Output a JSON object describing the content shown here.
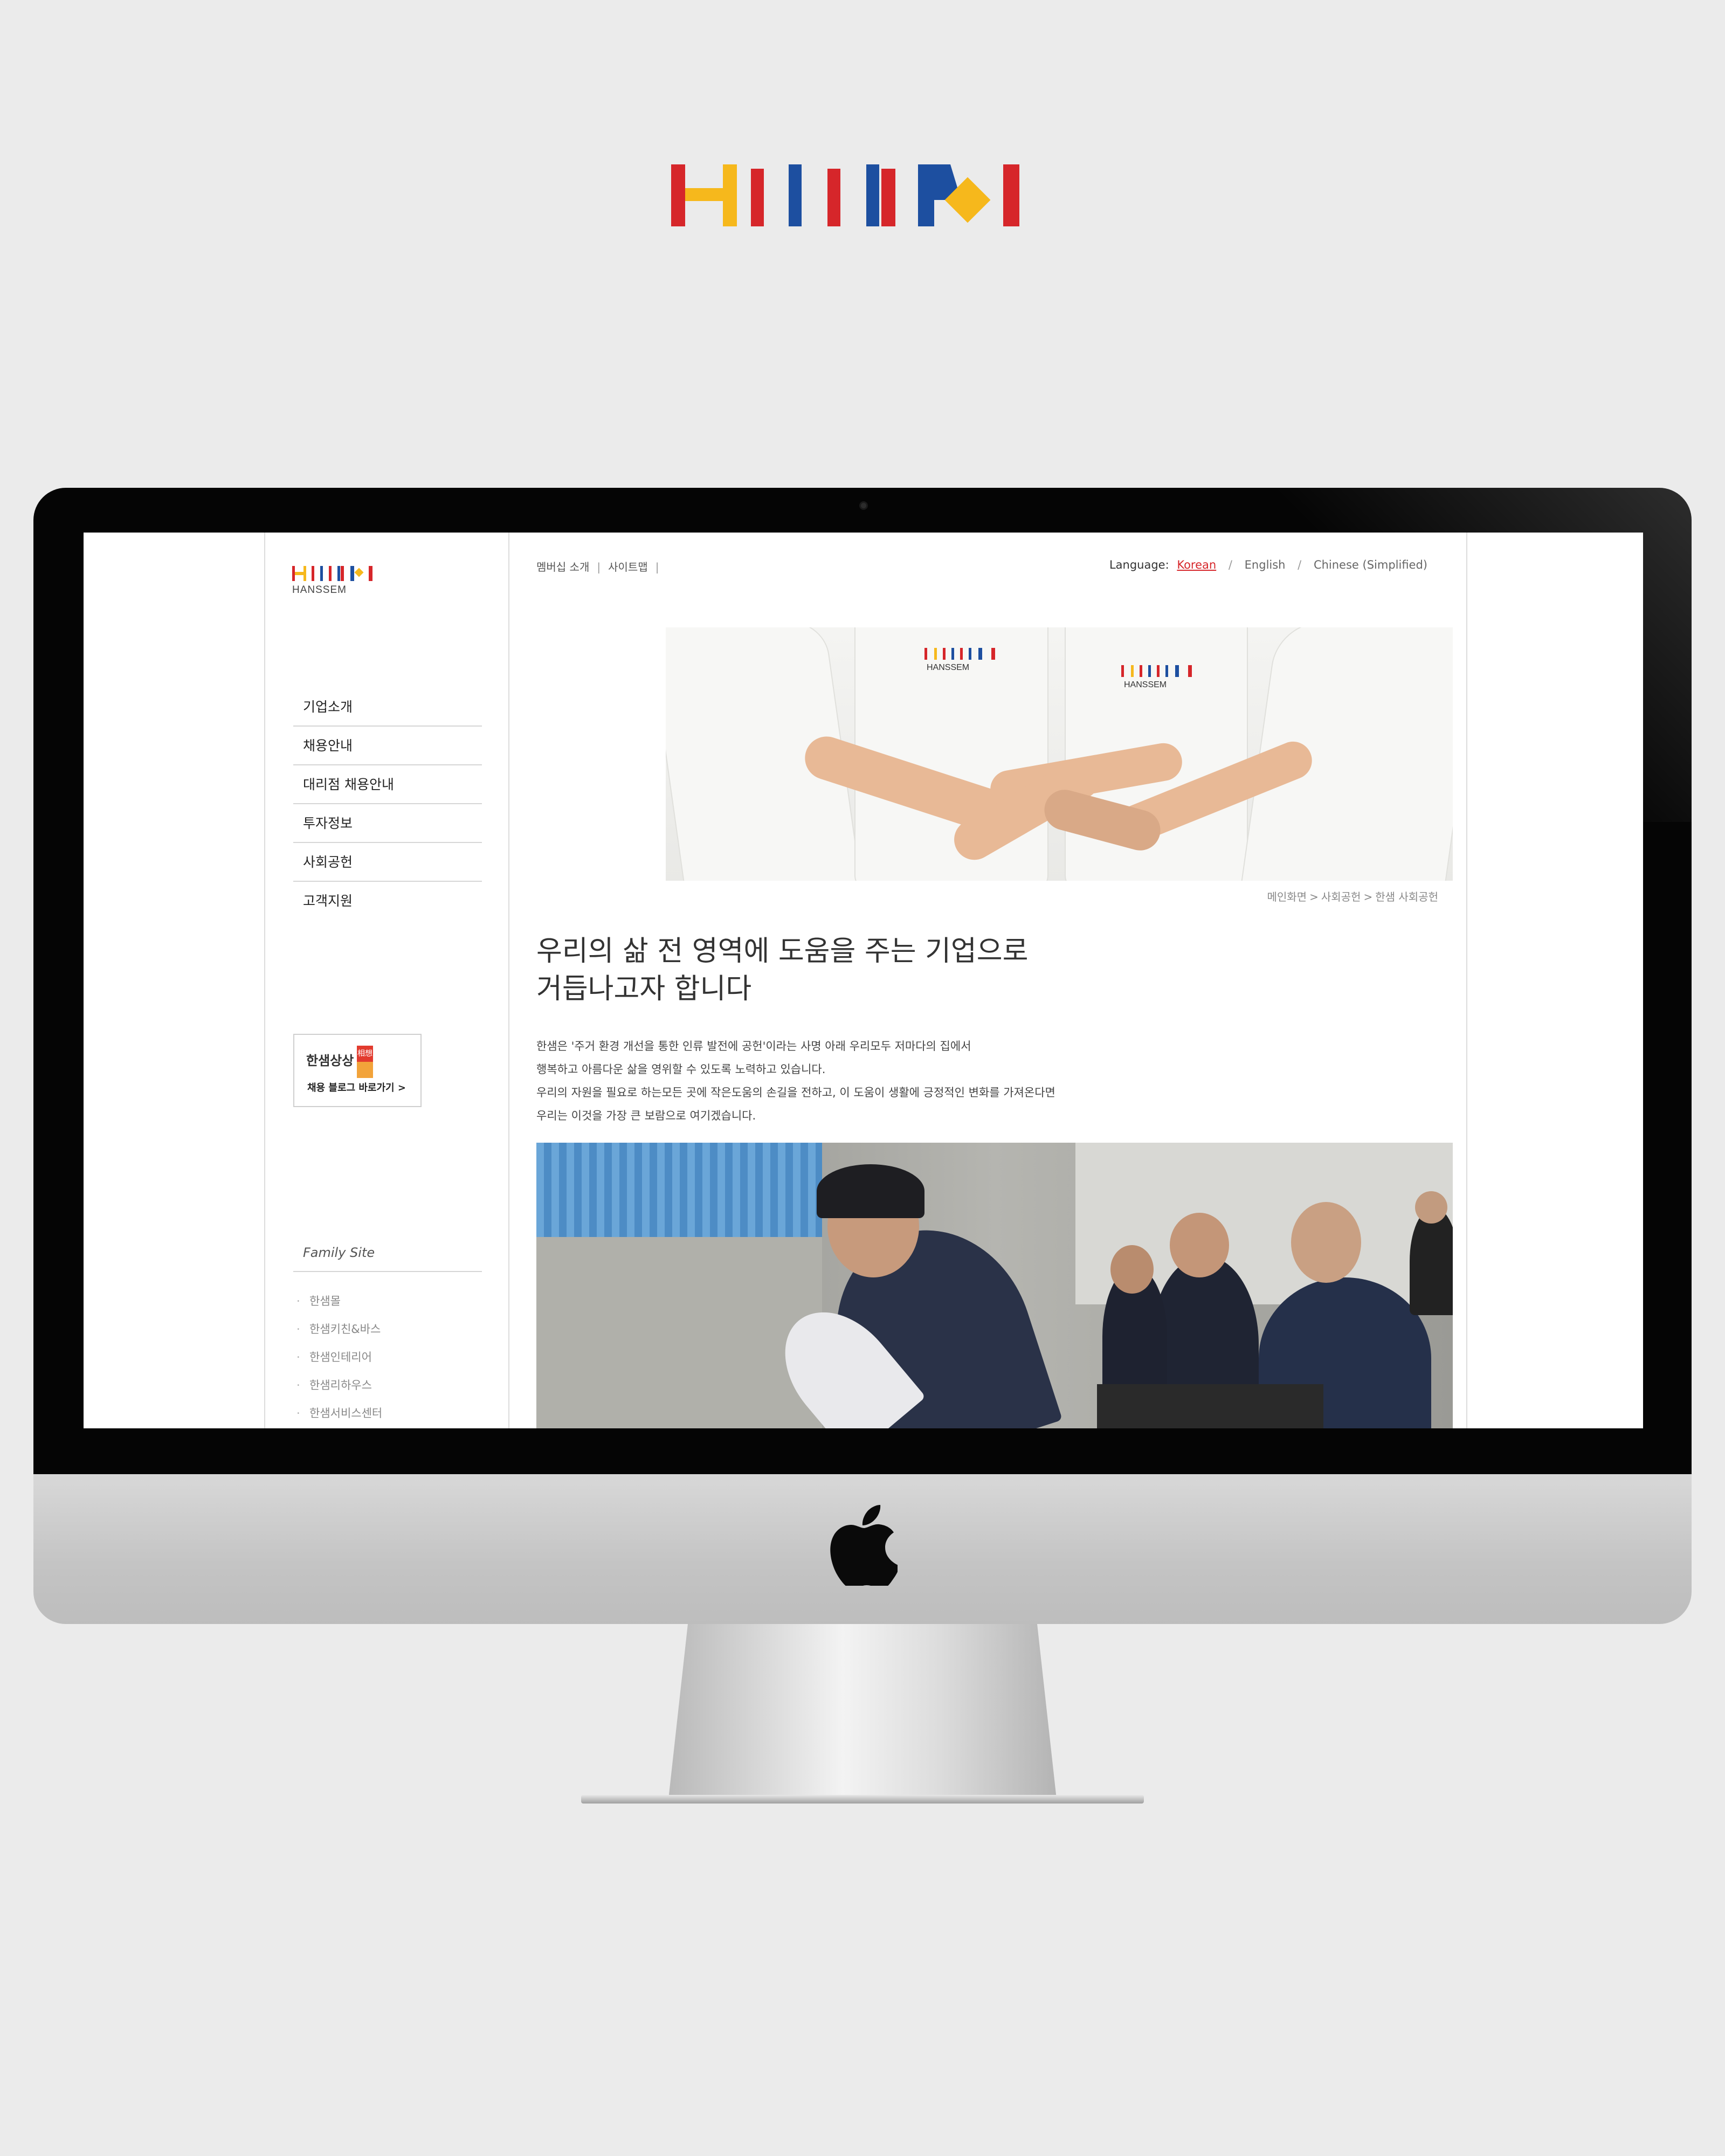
{
  "brand": {
    "colors": {
      "red": "#d6262a",
      "yellow": "#f6b81c",
      "blue": "#1d4fa0"
    }
  },
  "sidebar": {
    "logo_text": "HANSSEM",
    "nav": [
      {
        "label": "기업소개"
      },
      {
        "label": "채용안내"
      },
      {
        "label": "대리점 채용안내"
      },
      {
        "label": "투자정보"
      },
      {
        "label": "사회공헌"
      },
      {
        "label": "고객지원"
      }
    ],
    "recruit_box": {
      "title": "한샘상상",
      "seal": "相想",
      "link": "채용 블로그 바로가기 >"
    },
    "family": {
      "title": "Family Site",
      "items": [
        {
          "label": "한샘몰"
        },
        {
          "label": "한샘키친&바스"
        },
        {
          "label": "한샘인테리어"
        },
        {
          "label": "한샘리하우스"
        },
        {
          "label": "한샘서비스센터"
        }
      ]
    }
  },
  "header": {
    "util_links": [
      {
        "label": "멤버십 소개"
      },
      {
        "label": "사이트맵"
      }
    ],
    "language": {
      "label": "Language:",
      "active": "Korean",
      "options": [
        "English",
        "Chinese (Simplified)"
      ]
    }
  },
  "hero": {
    "shirt_logo": "HANSSEM"
  },
  "breadcrumb": [
    "메인화면",
    "사회공헌",
    "한샘 사회공헌"
  ],
  "headline": [
    "우리의 삶 전 영역에 도움을 주는 기업으로",
    "거듭나고자 합니다"
  ],
  "body": [
    "한샘은 '주거 환경 개선을 통한 인류 발전에 공헌'이라는 사명 아래 우리모두 저마다의 집에서",
    "행복하고 아름다운 삶을 영위할 수 있도록 노력하고 있습니다.",
    "우리의 자원을 필요로 하는모든 곳에 작은도움의 손길을 전하고, 이 도움이 생활에 긍정적인 변화를 가져온다면",
    "우리는 이것을 가장 큰 보람으로 여기겠습니다."
  ]
}
